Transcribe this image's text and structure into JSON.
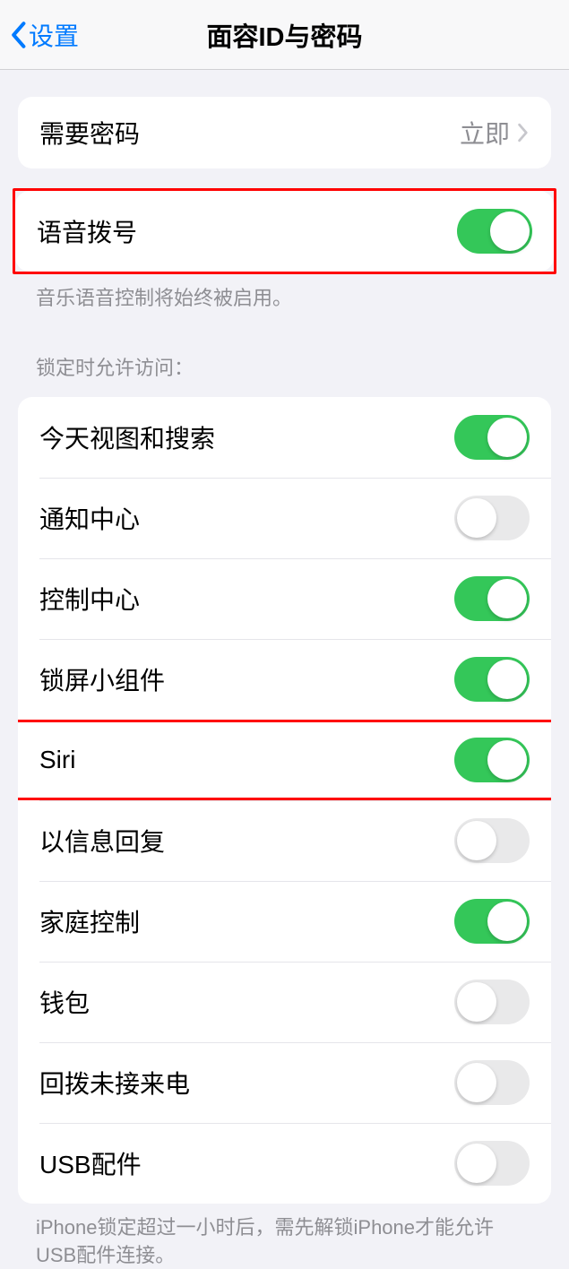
{
  "nav": {
    "back_label": "设置",
    "title": "面容ID与密码"
  },
  "passcode_row": {
    "label": "需要密码",
    "value": "立即"
  },
  "voice_dial": {
    "label": "语音拨号",
    "footer": "音乐语音控制将始终被启用。"
  },
  "lock_access": {
    "header": "锁定时允许访问：",
    "items": [
      {
        "label": "今天视图和搜索",
        "on": true
      },
      {
        "label": "通知中心",
        "on": false
      },
      {
        "label": "控制中心",
        "on": true
      },
      {
        "label": "锁屏小组件",
        "on": true
      },
      {
        "label": "Siri",
        "on": true
      },
      {
        "label": "以信息回复",
        "on": false
      },
      {
        "label": "家庭控制",
        "on": true
      },
      {
        "label": "钱包",
        "on": false
      },
      {
        "label": "回拨未接来电",
        "on": false
      },
      {
        "label": "USB配件",
        "on": false
      }
    ],
    "footer": "iPhone锁定超过一小时后，需先解锁iPhone才能允许USB配件连接。"
  }
}
